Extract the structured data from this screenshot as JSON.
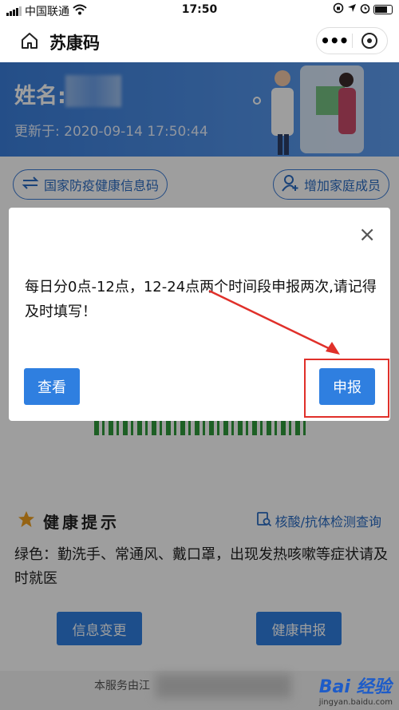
{
  "status_bar": {
    "carrier": "中国联通",
    "time": "17:50"
  },
  "nav": {
    "title": "苏康码",
    "more_label": "•••"
  },
  "banner": {
    "name_label": "姓名:",
    "update_text": "更新于: 2020-09-14 17:50:44"
  },
  "actions": {
    "national_code": "国家防疫健康信息码",
    "add_family": "增加家庭成员"
  },
  "health": {
    "title": "健康提示",
    "query_link": "核酸/抗体检测查询",
    "tip": "绿色：勤洗手、常通风、戴口罩，出现发热咳嗽等症状请及时就医",
    "info_change_button": "信息变更",
    "health_report_button": "健康申报"
  },
  "footer": {
    "service_text": "本服务由江"
  },
  "modal": {
    "close": "×",
    "message": "每日分0点-12点，12-24点两个时间段申报两次,请记得及时填写！",
    "view_button": "查看",
    "report_button": "申报"
  },
  "watermark": {
    "brand": "Bai 经验",
    "url": "jingyan.baidu.com"
  },
  "colors": {
    "primary": "#2f7fe0",
    "highlight": "#e0302a",
    "qr_green": "#2f9a3b"
  }
}
